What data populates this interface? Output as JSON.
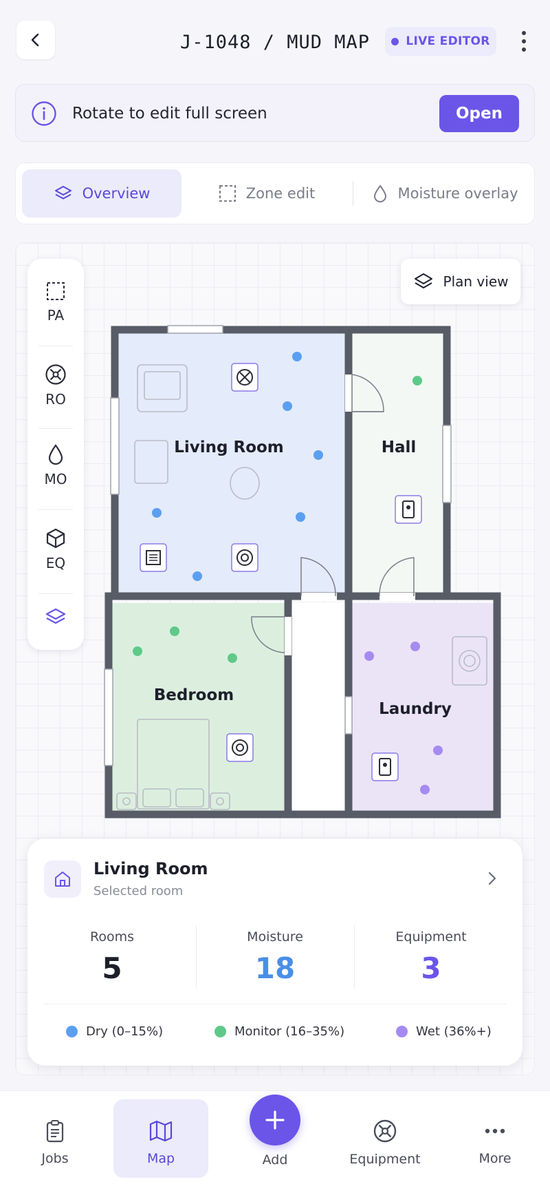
{
  "header": {
    "title": "J-1048 / MUD MAP",
    "badge": "LIVE EDITOR"
  },
  "banner": {
    "text": "Rotate to edit full screen",
    "button": "Open"
  },
  "tabs": [
    {
      "label": "Overview",
      "active": true
    },
    {
      "label": "Zone edit",
      "active": false
    },
    {
      "label": "Moisture overlay",
      "active": false
    }
  ],
  "tools": [
    {
      "label": "PA",
      "icon": "dashed-square-icon"
    },
    {
      "label": "RO",
      "icon": "fan-icon"
    },
    {
      "label": "MO",
      "icon": "droplet-icon"
    },
    {
      "label": "EQ",
      "icon": "cube-icon"
    },
    {
      "label": "",
      "icon": "layers-icon"
    }
  ],
  "plan_view_label": "Plan view",
  "rooms": {
    "living": "Living Room",
    "hall": "Hall",
    "bedroom": "Bedroom",
    "laundry": "Laundry"
  },
  "card": {
    "title": "Living Room",
    "subtitle": "Selected room",
    "stats": [
      {
        "label": "Rooms",
        "value": "5",
        "color": "#1d1f2b"
      },
      {
        "label": "Moisture",
        "value": "18",
        "color": "#4a8fe6"
      },
      {
        "label": "Equipment",
        "value": "3",
        "color": "#6a55e8"
      }
    ],
    "legend": [
      {
        "label": "Dry (0–15%)",
        "color": "#5b9ff0"
      },
      {
        "label": "Monitor (16–35%)",
        "color": "#5fc98a"
      },
      {
        "label": "Wet (36%+)",
        "color": "#a48bf0"
      }
    ]
  },
  "nav": {
    "jobs": "Jobs",
    "map": "Map",
    "add": "Add",
    "equipment": "Equipment",
    "more": "More"
  },
  "colors": {
    "accent": "#6a55e8",
    "dry": "#5b9ff0",
    "monitor": "#5fc98a",
    "wet": "#a48bf0",
    "wall": "#585c66"
  }
}
